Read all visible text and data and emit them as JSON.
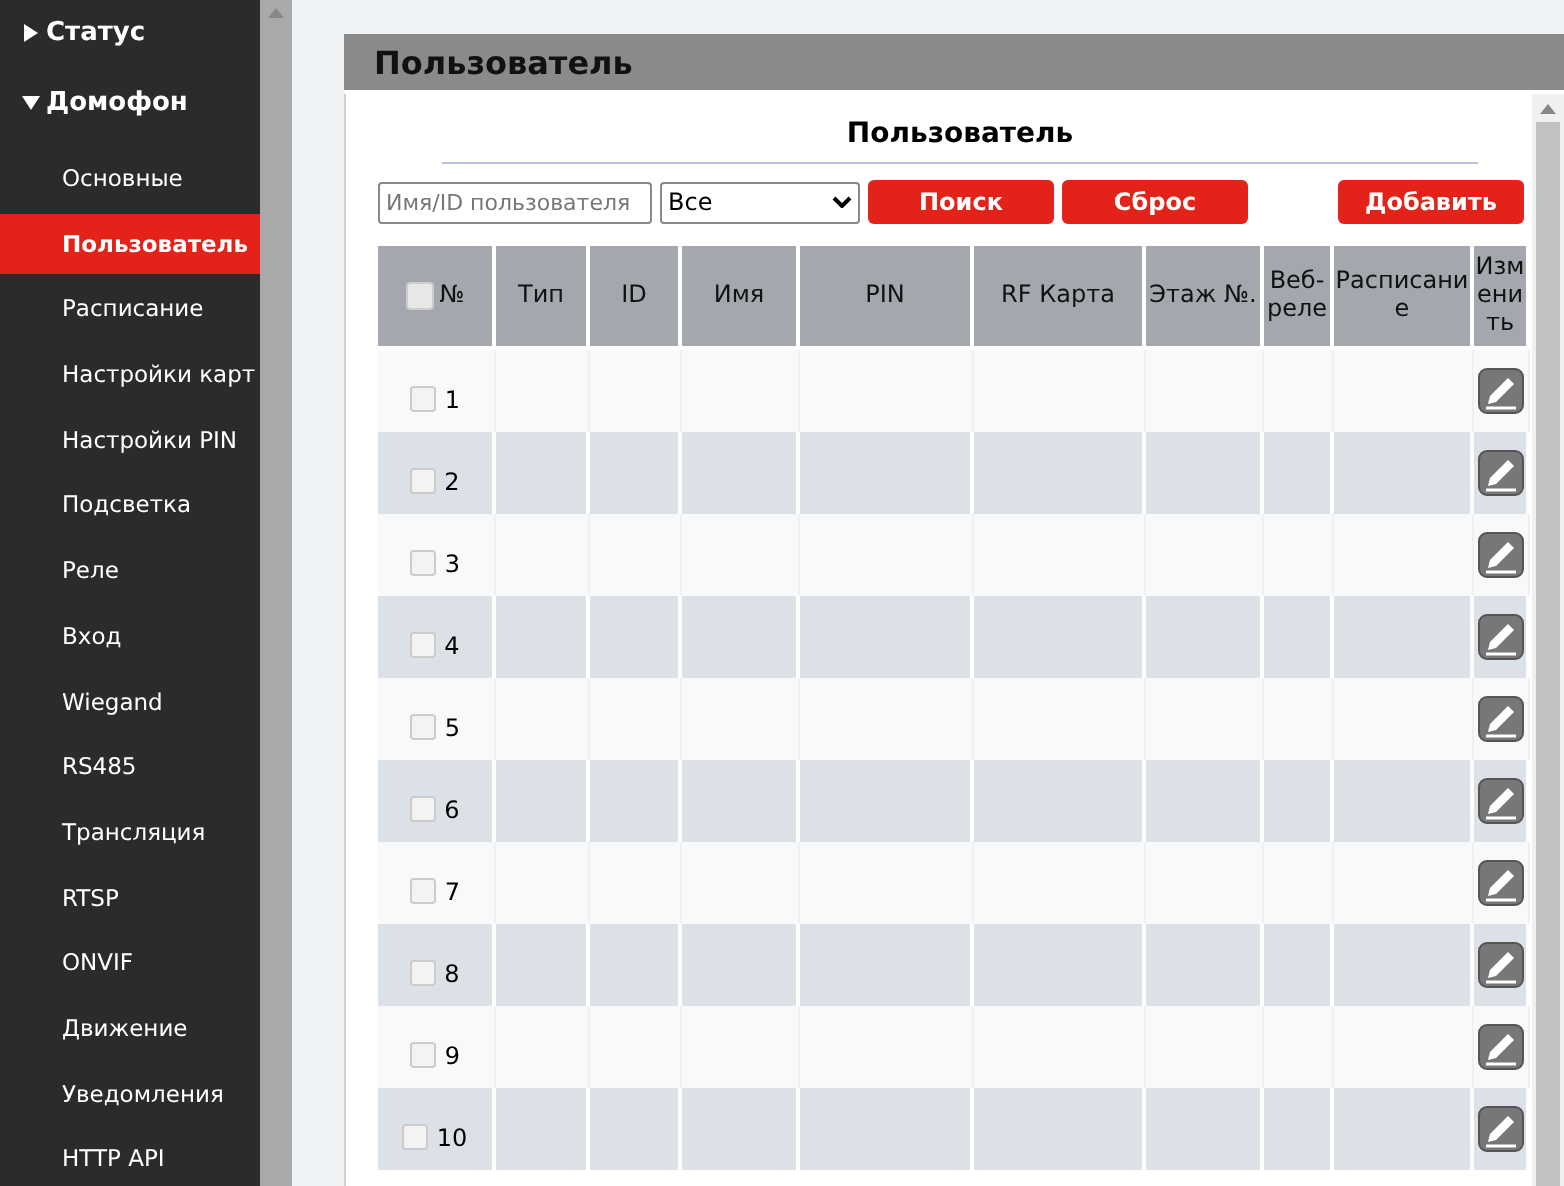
{
  "sidebar": {
    "groups": [
      {
        "label": "Статус",
        "expanded": false
      },
      {
        "label": "Домофон",
        "expanded": true,
        "items": [
          {
            "label": "Основные",
            "selected": false
          },
          {
            "label": "Пользователь",
            "selected": true
          },
          {
            "label": "Расписание",
            "selected": false
          },
          {
            "label": "Настройки карт",
            "selected": false
          },
          {
            "label": "Настройки PIN",
            "selected": false
          },
          {
            "label": "Подсветка",
            "selected": false
          },
          {
            "label": "Реле",
            "selected": false
          },
          {
            "label": "Вход",
            "selected": false
          },
          {
            "label": "Wiegand",
            "selected": false
          },
          {
            "label": "RS485",
            "selected": false
          },
          {
            "label": "Трансляция",
            "selected": false
          },
          {
            "label": "RTSP",
            "selected": false
          },
          {
            "label": "ONVIF",
            "selected": false
          },
          {
            "label": "Движение",
            "selected": false
          },
          {
            "label": "Уведомления",
            "selected": false
          },
          {
            "label": "HTTP API",
            "selected": false
          }
        ]
      }
    ]
  },
  "panel": {
    "title": "Пользователь",
    "subtitle": "Пользователь"
  },
  "toolbar": {
    "search": {
      "placeholder": "Имя/ID пользователя"
    },
    "filter": {
      "value": "Все"
    },
    "buttons": [
      "Поиск",
      "Сброс"
    ],
    "add_button": "Добавить"
  },
  "table": {
    "select_all_checked": false,
    "columns": [
      "№",
      "Тип",
      "ID",
      "Имя",
      "PIN",
      "RF Карта",
      "Этаж №.",
      "Веб-реле",
      "Расписание",
      "Изменить"
    ],
    "rows": [
      {
        "number": "1",
        "checked": false
      },
      {
        "number": "2",
        "checked": false
      },
      {
        "number": "3",
        "checked": false
      },
      {
        "number": "4",
        "checked": false
      },
      {
        "number": "5",
        "checked": false
      },
      {
        "number": "6",
        "checked": false
      },
      {
        "number": "7",
        "checked": false
      },
      {
        "number": "8",
        "checked": false
      },
      {
        "number": "9",
        "checked": false
      },
      {
        "number": "10",
        "checked": false
      }
    ]
  }
}
